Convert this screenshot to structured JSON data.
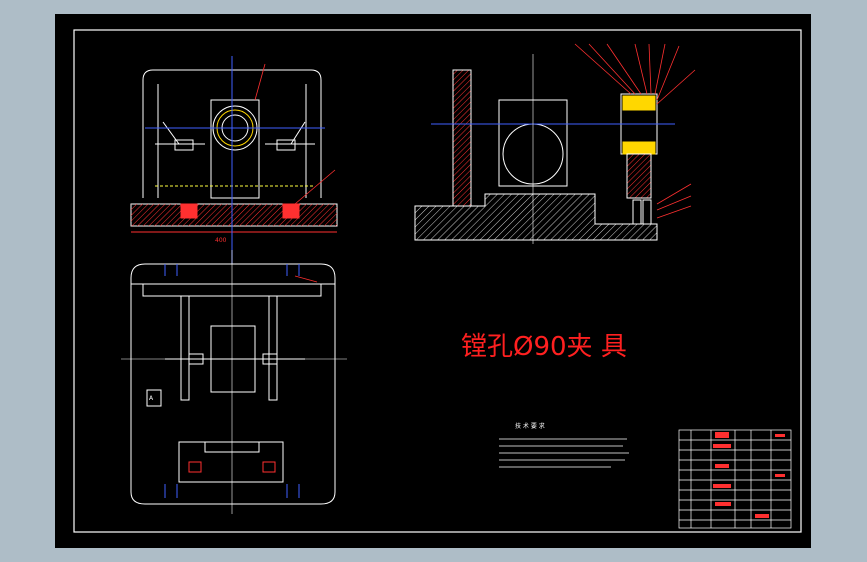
{
  "drawing": {
    "title": "镗孔Ø90夹 具",
    "tech_req": {
      "heading": "技 术 要 求"
    },
    "dimension_label": "400",
    "view_marker": "A",
    "colors": {
      "background": "#000000",
      "frame": "#ffffff",
      "outline": "#ffffff",
      "hatch": "#ff3030",
      "title": "#ff2020",
      "centerline": "#4060ff",
      "hidden": "#ffff40",
      "green": "#40ff40",
      "highlight": "#ffd700",
      "window_bg": "#aebdc7"
    }
  }
}
